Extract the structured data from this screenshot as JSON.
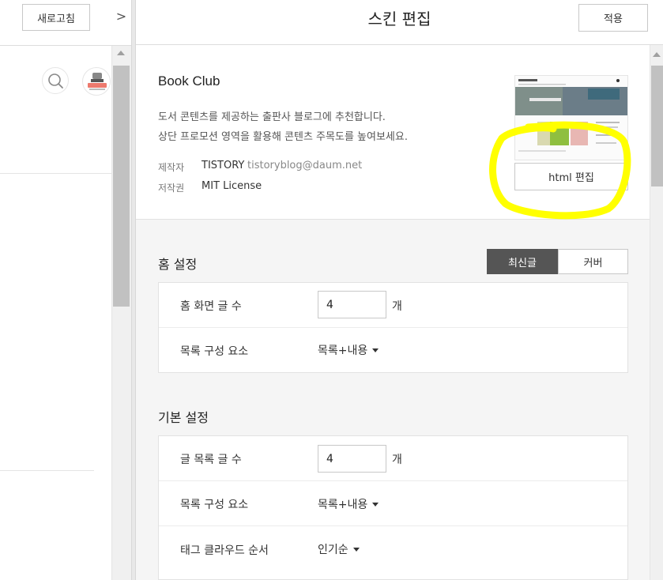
{
  "left": {
    "refresh_label": "새로고침",
    "collapse_glyph": ">"
  },
  "header": {
    "title": "스킨 편집",
    "apply_label": "적용"
  },
  "skin": {
    "name": "Book Club",
    "description_line1": "도서 콘텐츠를 제공하는 출판사 블로그에 추천합니다.",
    "description_line2": "상단 프로모션 영역을 활용해 콘텐츠 주목도를 높여보세요.",
    "maker_label": "제작자",
    "maker_name": "TISTORY",
    "maker_email": "tistoryblog@daum.net",
    "license_label": "저작권",
    "license_value": "MIT License",
    "html_edit_label": "html 편집"
  },
  "home_settings": {
    "title": "홈 설정",
    "segments": [
      "최신글",
      "커버"
    ],
    "active_segment": "최신글",
    "rows": [
      {
        "label": "홈 화면 글 수",
        "value": "4",
        "unit": "개"
      },
      {
        "label": "목록 구성 요소",
        "value": "목록+내용"
      }
    ]
  },
  "basic_settings": {
    "title": "기본 설정",
    "rows": [
      {
        "label": "글 목록 글 수",
        "value": "4",
        "unit": "개"
      },
      {
        "label": "목록 구성 요소",
        "value": "목록+내용"
      },
      {
        "label": "태그 클라우드 순서",
        "value": "인기순"
      }
    ]
  },
  "colors": {
    "highlight": "#ffff00",
    "segment_active_bg": "#555555"
  }
}
